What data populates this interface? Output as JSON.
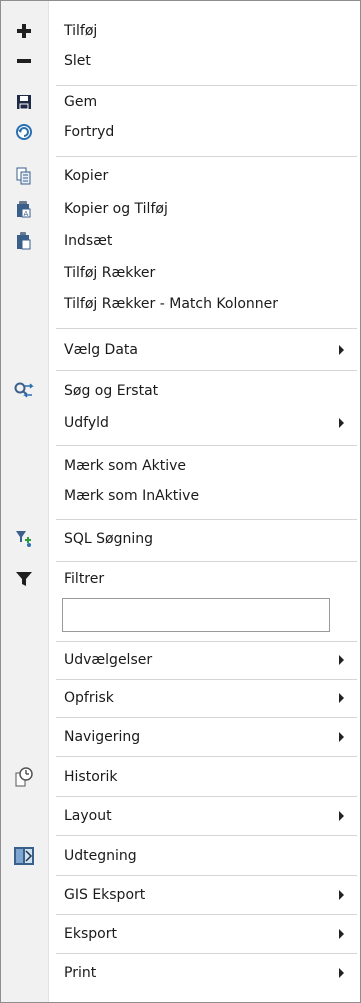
{
  "menu": {
    "items": {
      "tilfoj": {
        "label": "Tilføj",
        "icon": "plus-icon"
      },
      "slet": {
        "label": "Slet",
        "icon": "minus-icon"
      },
      "gem": {
        "label": "Gem",
        "icon": "save-icon"
      },
      "fortryd": {
        "label": "Fortryd",
        "icon": "undo-icon"
      },
      "kopier": {
        "label": "Kopier",
        "icon": "copy-icon"
      },
      "kopier_og_tilfoj": {
        "label": "Kopier og Tilføj",
        "icon": "copy-add-icon"
      },
      "indsaet": {
        "label": "Indsæt",
        "icon": "paste-icon"
      },
      "tilfoj_raekker": {
        "label": "Tilføj Rækker"
      },
      "tilfoj_raekker_match": {
        "label": "Tilføj Rækker - Match Kolonner"
      },
      "vaelg_data": {
        "label": "Vælg Data"
      },
      "sog_og_erstat": {
        "label": "Søg og Erstat",
        "icon": "search-replace-icon"
      },
      "udfyld": {
        "label": "Udfyld"
      },
      "maerk_aktive": {
        "label": "Mærk som Aktive"
      },
      "maerk_inaktive": {
        "label": "Mærk som InAktive"
      },
      "sql_sogning": {
        "label": "SQL Søgning",
        "icon": "sql-search-icon"
      },
      "filtrer": {
        "label": "Filtrer",
        "icon": "filter-icon"
      },
      "udvaelgelser": {
        "label": "Udvælgelser"
      },
      "opfrisk": {
        "label": "Opfrisk"
      },
      "navigering": {
        "label": "Navigering"
      },
      "historik": {
        "label": "Historik",
        "icon": "history-icon"
      },
      "layout": {
        "label": "Layout"
      },
      "udtegning": {
        "label": "Udtegning",
        "icon": "drawing-icon"
      },
      "gis_eksport": {
        "label": "GIS Eksport"
      },
      "eksport": {
        "label": "Eksport"
      },
      "print": {
        "label": "Print"
      }
    },
    "filter_value": ""
  },
  "colors": {
    "accent_blue": "#2a6fb0",
    "icon_dark": "#1f1f1f",
    "gutter": "#f1f1f1"
  }
}
